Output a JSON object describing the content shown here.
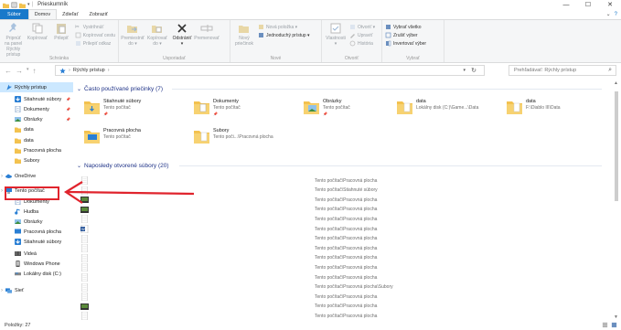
{
  "window": {
    "title": "Prieskumník",
    "controls": [
      "—",
      "☐",
      "✕"
    ]
  },
  "tabs": [
    {
      "label": "Súbor",
      "kind": "file"
    },
    {
      "label": "Domov",
      "kind": "active"
    },
    {
      "label": "Zdieľať",
      "kind": "normal"
    },
    {
      "label": "Zobraziť",
      "kind": "normal"
    }
  ],
  "ribbon": {
    "groups": [
      {
        "label": "Schránka",
        "big": [
          "Pripnúť na panel Rýchly prístup",
          "Kopírovať",
          "Prilepiť"
        ],
        "small": [
          "Vystrihnúť",
          "Kopírovať cestu",
          "Prilepiť odkaz"
        ]
      },
      {
        "label": "Usporiadať",
        "big": [
          "Premiestniť do ▾",
          "Kopírovať do ▾",
          "Odstrániť ▾",
          "Premenovať"
        ]
      },
      {
        "label": "Nové",
        "big": [
          "Nový priečinok"
        ],
        "small": [
          "Nová položka ▾",
          "Jednoduchý prístup ▾"
        ]
      },
      {
        "label": "Otvoriť",
        "big": [
          "Vlastnosti ▾"
        ],
        "small": [
          "Otvoriť ▾",
          "Upraviť",
          "História"
        ]
      },
      {
        "label": "Vybrať",
        "small": [
          "Vybrať všetko",
          "Zrušiť výber",
          "Invertovať výber"
        ]
      }
    ]
  },
  "address": {
    "path": "Rýchly prístup",
    "search_placeholder": "Prehľadávať: Rýchly prístup"
  },
  "nav": {
    "items": [
      {
        "label": "Rýchly prístup",
        "icon": "star-icon",
        "selected": true,
        "pinned": false,
        "indent": 0
      },
      {
        "label": "Stiahnuté súbory",
        "icon": "download-icon",
        "pinned": true,
        "indent": 1
      },
      {
        "label": "Dokumenty",
        "icon": "documents-icon",
        "pinned": true,
        "indent": 1
      },
      {
        "label": "Obrázky",
        "icon": "pictures-icon",
        "pinned": true,
        "indent": 1
      },
      {
        "label": "data",
        "icon": "folder-icon",
        "pinned": false,
        "indent": 1
      },
      {
        "label": "data",
        "icon": "folder-icon",
        "pinned": false,
        "indent": 1
      },
      {
        "label": "Pracovná plocha",
        "icon": "folder-icon",
        "pinned": false,
        "indent": 1
      },
      {
        "label": "Subory",
        "icon": "folder-icon",
        "pinned": false,
        "indent": 1
      },
      {
        "label": "OneDrive",
        "icon": "cloud-icon",
        "pinned": false,
        "indent": 0
      },
      {
        "label": "Tento počítač",
        "icon": "computer-icon",
        "pinned": false,
        "indent": 0
      },
      {
        "label": "Dokumenty",
        "icon": "documents-icon",
        "pinned": false,
        "indent": 1
      },
      {
        "label": "Hudba",
        "icon": "music-icon",
        "pinned": false,
        "indent": 1
      },
      {
        "label": "Obrázky",
        "icon": "pictures-icon",
        "pinned": false,
        "indent": 1
      },
      {
        "label": "Pracovná plocha",
        "icon": "desktop-icon",
        "pinned": false,
        "indent": 1
      },
      {
        "label": "Stiahnuté súbory",
        "icon": "download-icon",
        "pinned": false,
        "indent": 1
      },
      {
        "label": "Videá",
        "icon": "video-icon",
        "pinned": false,
        "indent": 1
      },
      {
        "label": "Windows Phone",
        "icon": "phone-icon",
        "pinned": false,
        "indent": 1
      },
      {
        "label": "Lokálny disk (C:)",
        "icon": "drive-icon",
        "pinned": false,
        "indent": 1
      },
      {
        "label": "Sieť",
        "icon": "network-icon",
        "pinned": false,
        "indent": 0
      }
    ]
  },
  "frequent": {
    "heading": "Často používané priečinky (7)",
    "tiles": [
      {
        "name": "Stiahnuté súbory",
        "sub": "Tento počítač",
        "pinned": true,
        "icon": "download-folder-icon"
      },
      {
        "name": "Dokumenty",
        "sub": "Tento počítač",
        "pinned": true,
        "icon": "documents-folder-icon"
      },
      {
        "name": "Obrázky",
        "sub": "Tento počítač",
        "pinned": true,
        "icon": "pictures-folder-icon"
      },
      {
        "name": "data",
        "sub": "Lokálny disk (C:)\\Game...\\Data",
        "pinned": false,
        "icon": "folder-icon"
      },
      {
        "name": "data",
        "sub": "F:\\Diablo III\\Data",
        "pinned": false,
        "icon": "folder-icon"
      },
      {
        "name": "Pracovná plocha",
        "sub": "Tento počítač",
        "pinned": false,
        "icon": "desktop-folder-icon"
      },
      {
        "name": "Subory",
        "sub": "Tento poči...\\Pracovná plocha",
        "pinned": false,
        "icon": "folder-icon"
      }
    ]
  },
  "recent": {
    "heading": "Naposledy otvorené súbory (20)",
    "rows": [
      {
        "thumb": "doc-thumb-icon",
        "location": "Tento počítač\\Pracovná plocha"
      },
      {
        "thumb": "doc-thumb-icon",
        "location": "Tento počítač\\Stiahnuté súbory"
      },
      {
        "thumb": "image-thumb-icon",
        "location": "Tento počítač\\Pracovná plocha"
      },
      {
        "thumb": "image-thumb-icon",
        "location": "Tento počítač\\Pracovná plocha"
      },
      {
        "thumb": "doc-thumb-icon",
        "location": "Tento počítač\\Pracovná plocha"
      },
      {
        "thumb": "word-thumb-icon",
        "location": "Tento počítač\\Pracovná plocha"
      },
      {
        "thumb": "doc-thumb-icon",
        "location": "Tento počítač\\Pracovná plocha"
      },
      {
        "thumb": "doc-thumb-icon",
        "location": "Tento počítač\\Pracovná plocha"
      },
      {
        "thumb": "doc-thumb-icon",
        "location": "Tento počítač\\Pracovná plocha"
      },
      {
        "thumb": "doc-thumb-icon",
        "location": "Tento počítač\\Pracovná plocha"
      },
      {
        "thumb": "doc-thumb-icon",
        "location": "Tento počítač\\Pracovná plocha"
      },
      {
        "thumb": "doc-thumb-icon",
        "location": "Tento počítač\\Pracovná plocha\\Subory"
      },
      {
        "thumb": "doc-thumb-icon",
        "location": "Tento počítač\\Pracovná plocha"
      },
      {
        "thumb": "image-thumb-icon",
        "location": "Tento počítač\\Pracovná plocha"
      },
      {
        "thumb": "doc-thumb-icon",
        "location": "Tento počítač\\Pracovná plocha"
      }
    ]
  },
  "status": {
    "count": "Položky: 27"
  },
  "colors": {
    "accent": "#1979ca",
    "selection": "#cce8ff",
    "annotation": "#e0242d",
    "folder": "#f3c24f",
    "heading": "#1e3287"
  }
}
